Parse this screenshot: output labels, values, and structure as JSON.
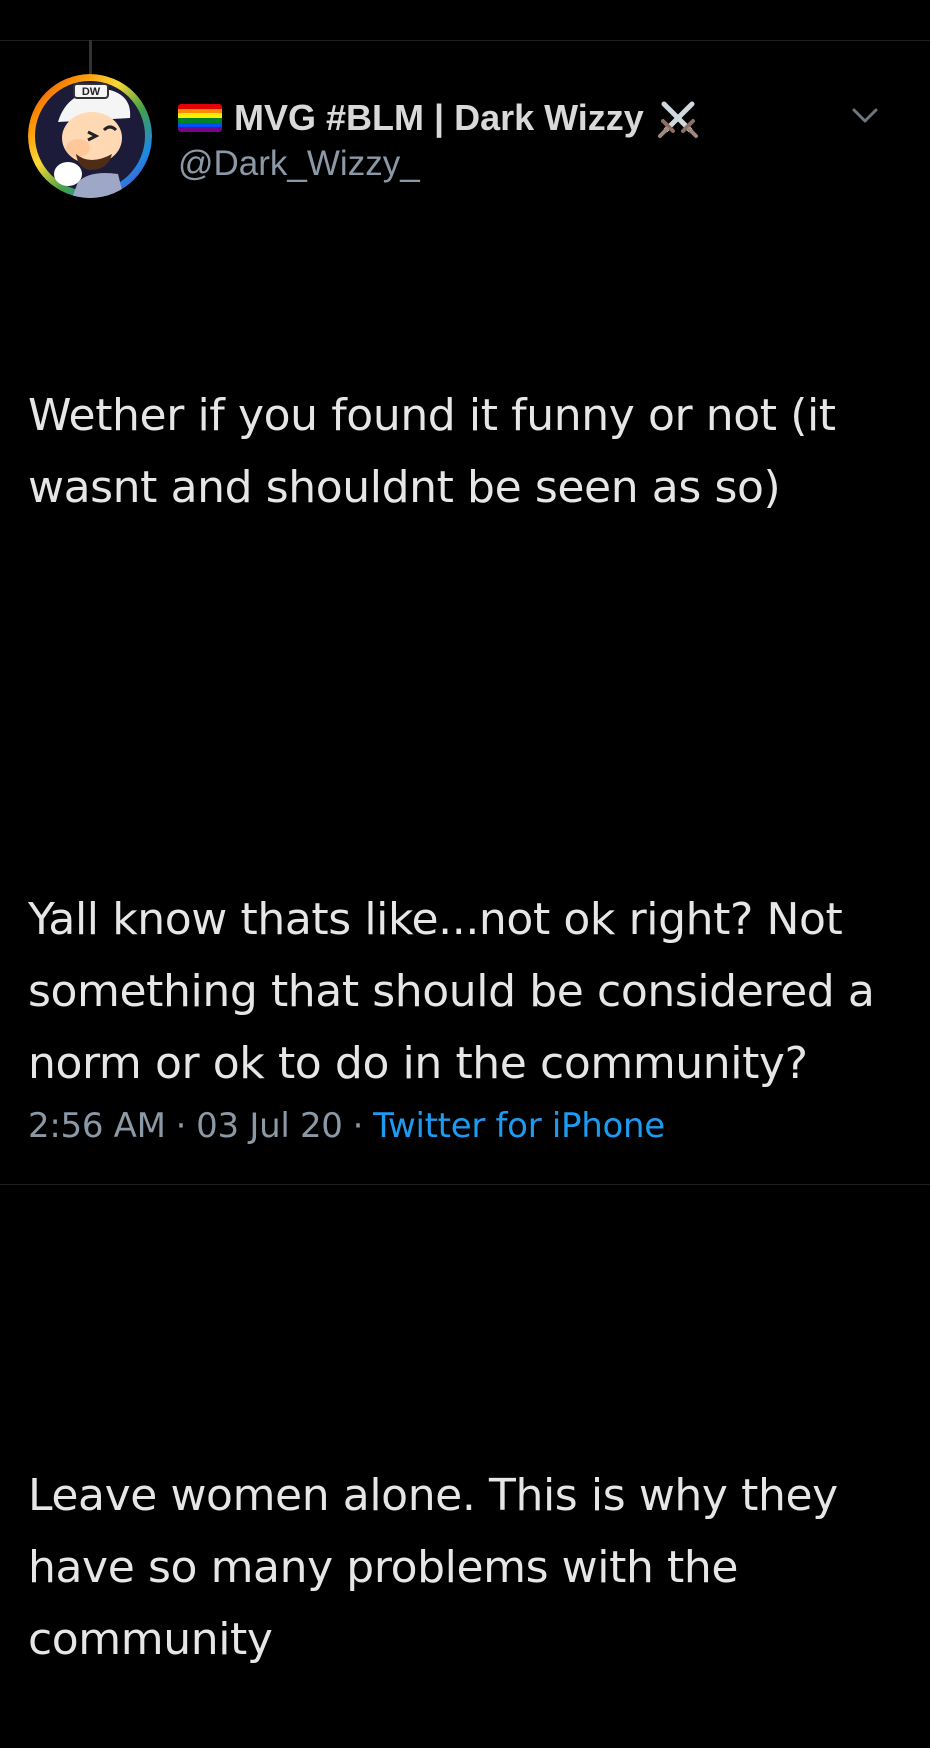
{
  "author": {
    "display_name": "MVG #BLM | Dark Wizzy",
    "handle": "@Dark_Wizzy_",
    "avatar_text": "DW"
  },
  "tweet": {
    "paragraphs": [
      "Wether if you found it funny or not (it wasnt and shouldnt be seen as so)",
      "Yall know thats like...not ok right? Not something that should be considered a norm or ok to do in the community?",
      "Leave women alone. This is why they have so many problems with the community"
    ],
    "time": "2:56 AM",
    "date": "03 Jul 20",
    "source": "Twitter for iPhone",
    "separator": "·"
  },
  "icons": {
    "flag": "rainbow-flag-icon",
    "swords": "crossed-swords-icon",
    "menu": "chevron-down-icon"
  },
  "colors": {
    "background": "#000000",
    "text": "#e6e6e6",
    "muted": "#8b98a5",
    "link": "#1d9bf0"
  }
}
